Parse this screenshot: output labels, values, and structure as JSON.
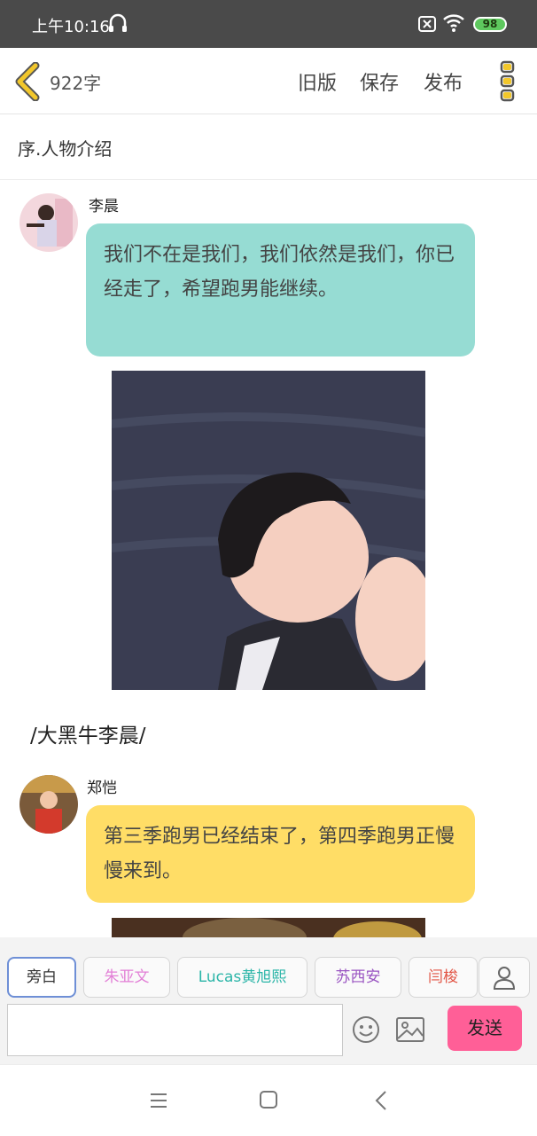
{
  "status_bar": {
    "time": "上午10:16",
    "battery": "98"
  },
  "top_bar": {
    "word_count": "922字",
    "old_version": "旧版",
    "save": "保存",
    "publish": "发布"
  },
  "chapter": {
    "title": "序.人物介绍"
  },
  "messages": [
    {
      "name": "李晨",
      "text": "我们不在是我们，我们依然是我们，你已经走了，希望跑男能继续。",
      "bubble_color": "#96dcd3"
    },
    {
      "name": "郑恺",
      "text": "第三季跑男已经结束了，第四季跑男正慢慢来到。",
      "bubble_color": "#ffdd66"
    }
  ],
  "narration": {
    "text": "/大黑牛李晨/"
  },
  "character_chips": [
    {
      "label": "旁白",
      "color": "#333333"
    },
    {
      "label": "朱亚文",
      "color": "#e27fd6"
    },
    {
      "label": "Lucas黄旭熙",
      "color": "#2bb5a8"
    },
    {
      "label": "苏西安",
      "color": "#9a55c2"
    },
    {
      "label": "闫梭",
      "color": "#e25545"
    }
  ],
  "input": {
    "placeholder": "",
    "send_label": "发送"
  },
  "colors": {
    "accent_send": "#ff5f97",
    "back_arrow": "#f2c72b"
  }
}
